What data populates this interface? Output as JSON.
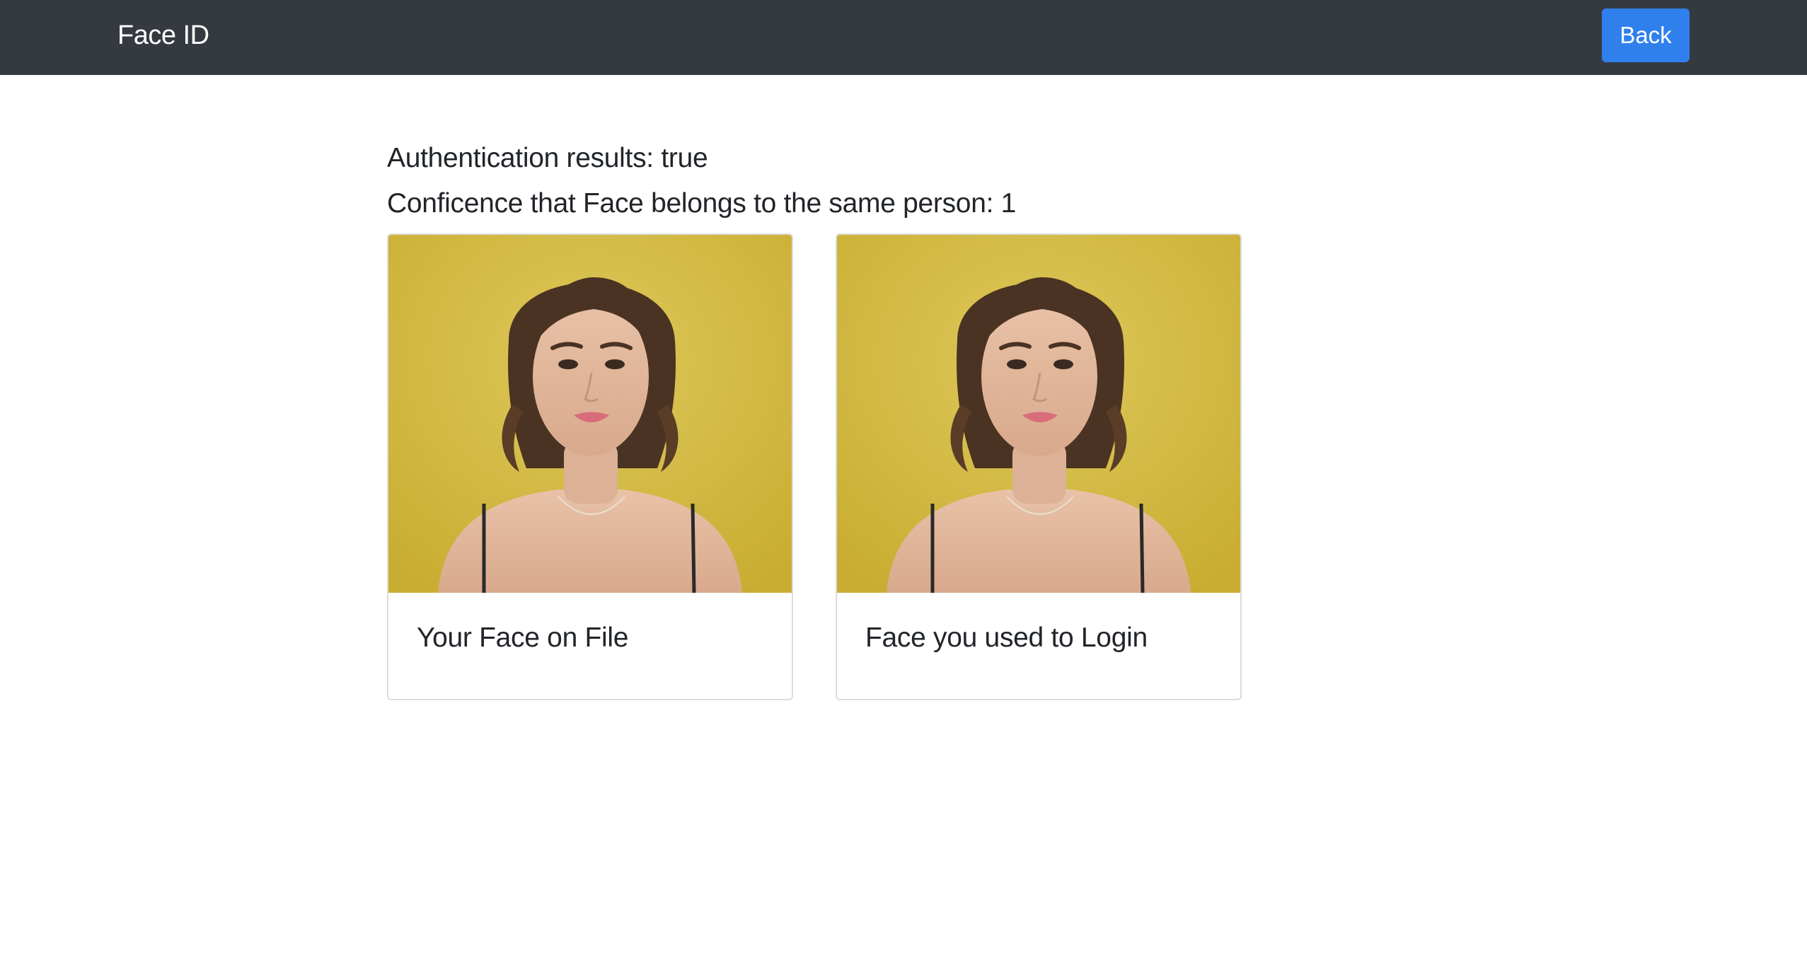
{
  "navbar": {
    "brand": "Face ID",
    "back_label": "Back",
    "background": "#343a40",
    "back_color": "#2f80ed"
  },
  "results": {
    "authentication": "Authentication results: true",
    "confidence": "Conficence that Face belongs to the same person: 1"
  },
  "cards": [
    {
      "title": "Your Face on File",
      "image": "portrait-photo"
    },
    {
      "title": "Face you used to Login",
      "image": "portrait-photo"
    }
  ]
}
